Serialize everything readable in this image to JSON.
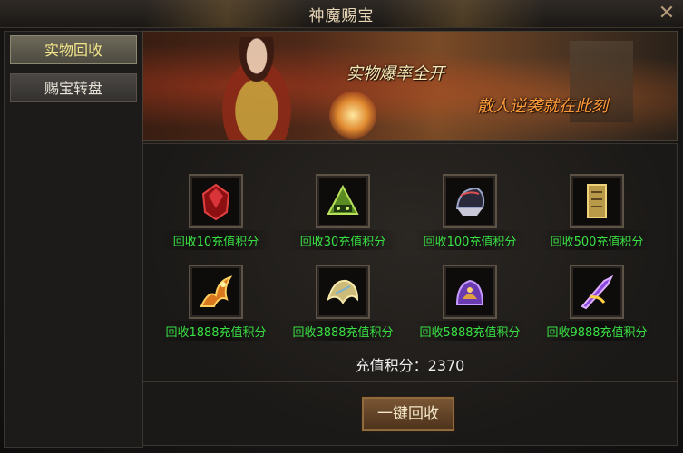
{
  "window": {
    "title": "神魔赐宝",
    "close_label": "✕"
  },
  "sidebar": {
    "items": [
      {
        "label": "实物回收",
        "active": true
      },
      {
        "label": "赐宝转盘",
        "active": false
      }
    ]
  },
  "banner": {
    "line1": "实物爆率全开",
    "line2": "散人逆袭就在此刻"
  },
  "items": [
    {
      "label": "回收10充值积分",
      "icon": "red-gem-icon"
    },
    {
      "label": "回收30充值积分",
      "icon": "green-helmet-icon"
    },
    {
      "label": "回收100充值积分",
      "icon": "dark-helmet-icon"
    },
    {
      "label": "回收500充值积分",
      "icon": "gold-scroll-icon"
    },
    {
      "label": "回收1888充值积分",
      "icon": "flame-dragon-icon"
    },
    {
      "label": "回收3888充值积分",
      "icon": "gold-wing-icon"
    },
    {
      "label": "回收5888充值积分",
      "icon": "purple-beast-icon"
    },
    {
      "label": "回收9888充值积分",
      "icon": "purple-blade-icon"
    }
  ],
  "points": {
    "text": "充值积分：2370"
  },
  "actions": {
    "recycle_all_label": "一键回收"
  },
  "colors": {
    "item_label": "#39e043",
    "active_tab_text": "#f3e58a",
    "banner_highlight": "#ff9c3a"
  }
}
